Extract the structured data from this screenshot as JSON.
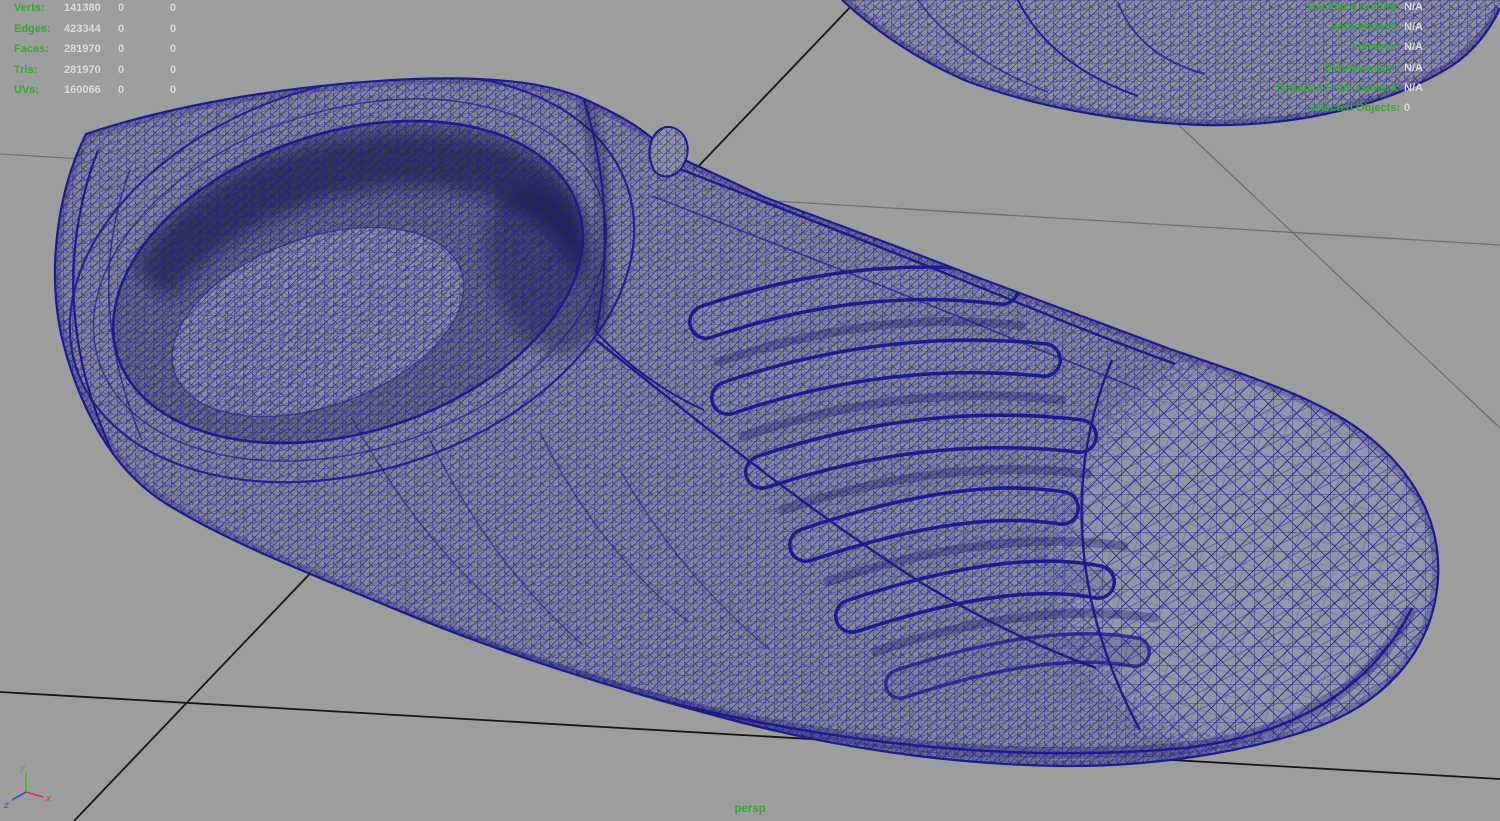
{
  "colors": {
    "background": "#9d9d9d",
    "hud_label": "#35a835",
    "hud_value": "#dcdcdc",
    "wireframe": "#1e1e96",
    "grid_black": "#161616",
    "grid_gray": "#6e6e6e",
    "axis_x": "#e03030",
    "axis_y": "#2fc02f",
    "axis_z": "#3050e0"
  },
  "hud_poly_count": {
    "rows": [
      {
        "label": "Verts:",
        "values": [
          "141380",
          "0",
          "0"
        ]
      },
      {
        "label": "Edges:",
        "values": [
          "423344",
          "0",
          "0"
        ]
      },
      {
        "label": "Faces:",
        "values": [
          "281970",
          "0",
          "0"
        ]
      },
      {
        "label": "Tris:",
        "values": [
          "281970",
          "0",
          "0"
        ]
      },
      {
        "label": "UVs:",
        "values": [
          "160066",
          "0",
          "0"
        ]
      }
    ]
  },
  "hud_object_details": {
    "rows": [
      {
        "label": "Backface Culling:",
        "value": "N/A"
      },
      {
        "label": "Smoothness:",
        "value": "N/A"
      },
      {
        "label": "Instance:",
        "value": "N/A"
      },
      {
        "label": "Display Layer:",
        "value": "N/A"
      },
      {
        "label": "Distance From Camera:",
        "value": "N/A"
      },
      {
        "label": "Selected Objects:",
        "value": "0"
      }
    ]
  },
  "camera": {
    "label": "persp"
  },
  "axis_gizmo": {
    "x": "x",
    "y": "y",
    "z": "z"
  }
}
